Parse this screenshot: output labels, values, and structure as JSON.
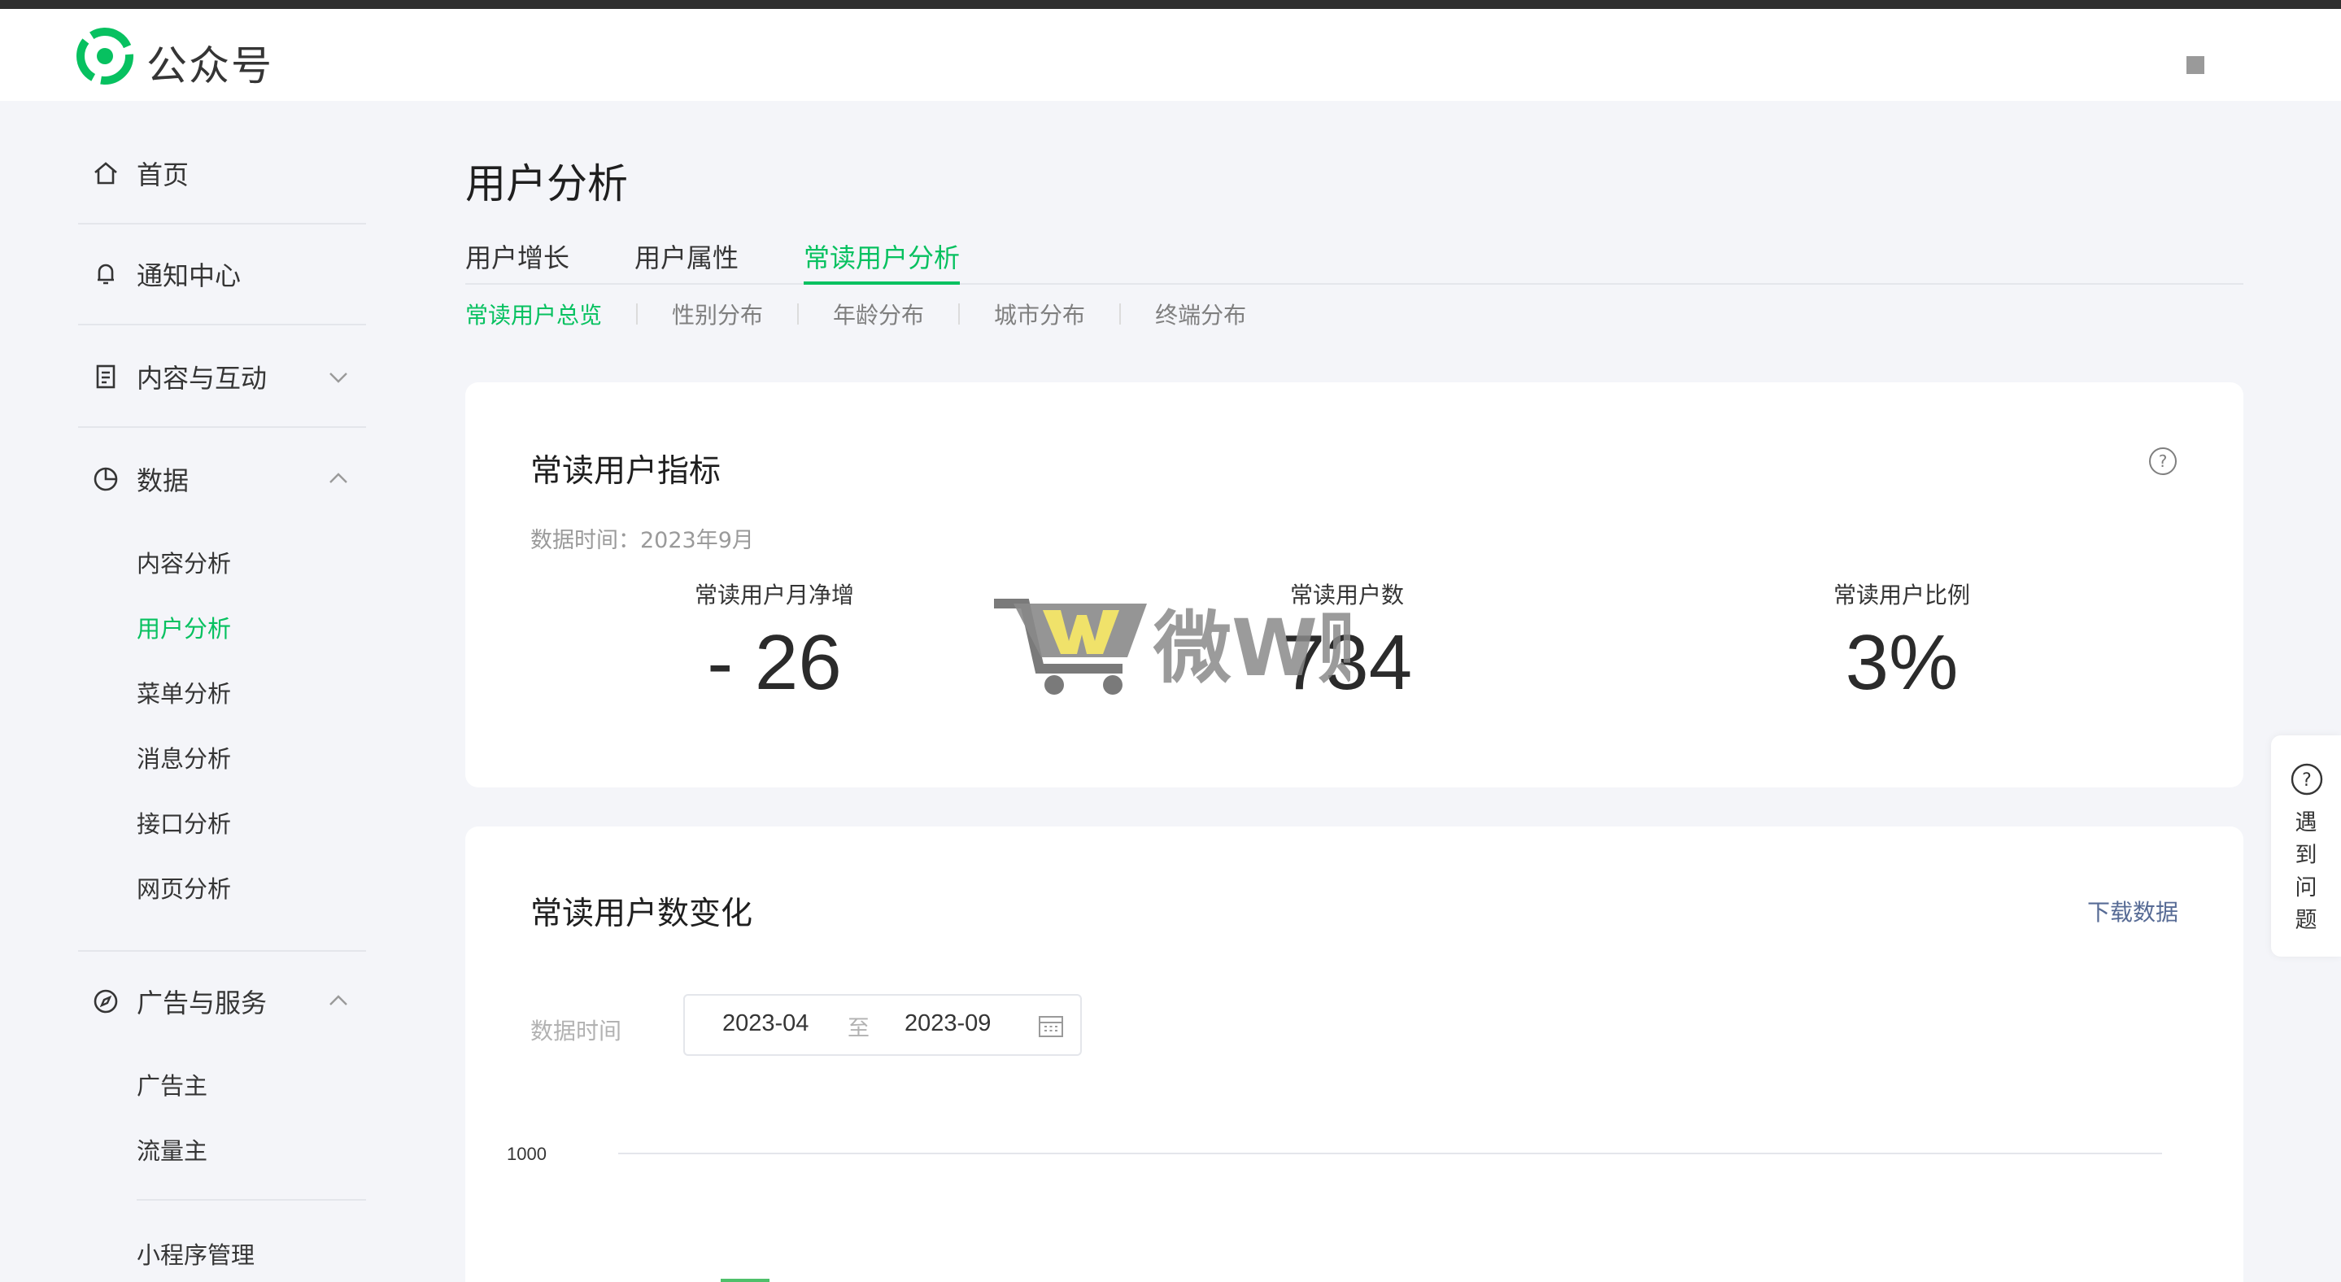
{
  "app": {
    "brand": "公众号"
  },
  "sidebar": {
    "home": "首页",
    "notifications": "通知中心",
    "content": "内容与互动",
    "data": "数据",
    "data_items": [
      "内容分析",
      "用户分析",
      "菜单分析",
      "消息分析",
      "接口分析",
      "网页分析"
    ],
    "ads": "广告与服务",
    "ads_items": [
      "广告主",
      "流量主",
      "小程序管理"
    ]
  },
  "page": {
    "title": "用户分析",
    "tabs": [
      "用户增长",
      "用户属性",
      "常读用户分析"
    ],
    "subtabs": [
      "常读用户总览",
      "性别分布",
      "年龄分布",
      "城市分布",
      "终端分布"
    ]
  },
  "metrics_card": {
    "title": "常读用户指标",
    "data_time": "数据时间：2023年9月",
    "metrics": [
      {
        "label": "常读用户月净增",
        "value": "- 26"
      },
      {
        "label": "常读用户数",
        "value": "734"
      },
      {
        "label": "常读用户比例",
        "value": "3%"
      }
    ]
  },
  "trend_card": {
    "title": "常读用户数变化",
    "download": "下载数据",
    "range_label": "数据时间",
    "range_from": "2023-04",
    "range_sep": "至",
    "range_to": "2023-09"
  },
  "chart_data": {
    "type": "bar",
    "y_ticks": [
      "1000"
    ],
    "note": "visible bars partially cut off at bottom"
  },
  "float_help": {
    "text": "遇到问题"
  },
  "watermark": {
    "text": "微W购"
  },
  "colors": {
    "accent": "#07c160",
    "link": "#576b95",
    "bar": "#4fc06b"
  }
}
